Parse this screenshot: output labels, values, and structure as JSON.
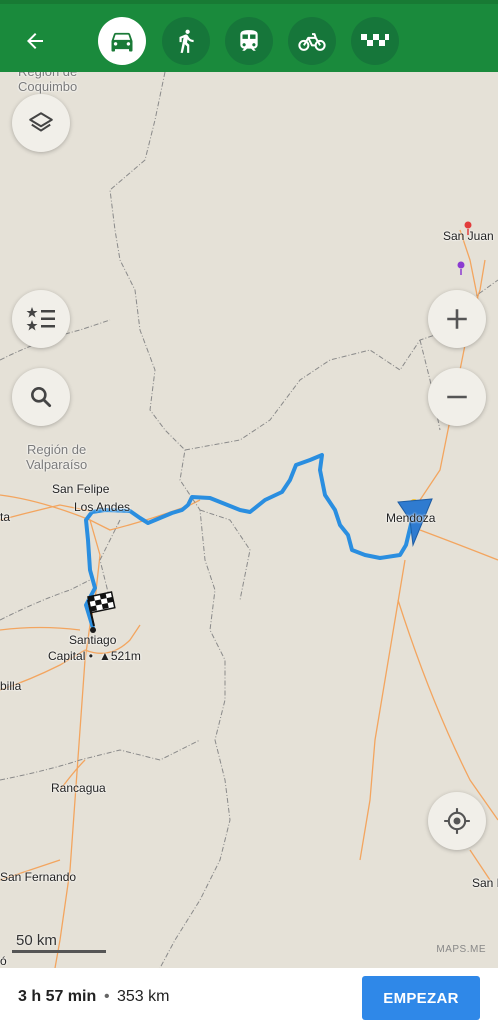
{
  "header": {
    "back_icon": "arrow-left-icon",
    "modes": [
      {
        "name": "car",
        "icon": "car-icon",
        "active": true
      },
      {
        "name": "pedestrian",
        "icon": "walk-icon",
        "active": false
      },
      {
        "name": "transit",
        "icon": "train-icon",
        "active": false
      },
      {
        "name": "bicycle",
        "icon": "bicycle-icon",
        "active": false
      },
      {
        "name": "taxi",
        "icon": "taxi-icon",
        "active": false
      }
    ]
  },
  "map": {
    "labels": {
      "coquimbo": "Región de\nCoquimbo",
      "san_juan": "San Juan",
      "valparaiso": "Región de\nValparaíso",
      "san_felipe": "San Felipe",
      "los_andes": "Los Andes",
      "mendoza": "Mendoza",
      "santiago": "Santiago",
      "capital": "Capital •",
      "peak": "▲521m",
      "rancagua": "Rancagua",
      "san_fernando": "San Fernando",
      "ta": "ta",
      "billa": "billa",
      "san_r": "San R",
      "o": "ó"
    },
    "scale": "50 km",
    "watermark": "MAPS.ME",
    "colors": {
      "route": "#2a8ee0",
      "road": "#f3a55f",
      "border": "#7d7d7d"
    }
  },
  "controls": {
    "layers_icon": "layers-icon",
    "bookmarks_icon": "bookmarks-list-icon",
    "search_icon": "search-icon",
    "zoom_in_icon": "plus-icon",
    "zoom_out_icon": "minus-icon",
    "location_icon": "my-location-icon"
  },
  "route_summary": {
    "time": "3 h 57 min",
    "separator": "•",
    "distance": "353 km",
    "start_label": "EMPEZAR"
  }
}
